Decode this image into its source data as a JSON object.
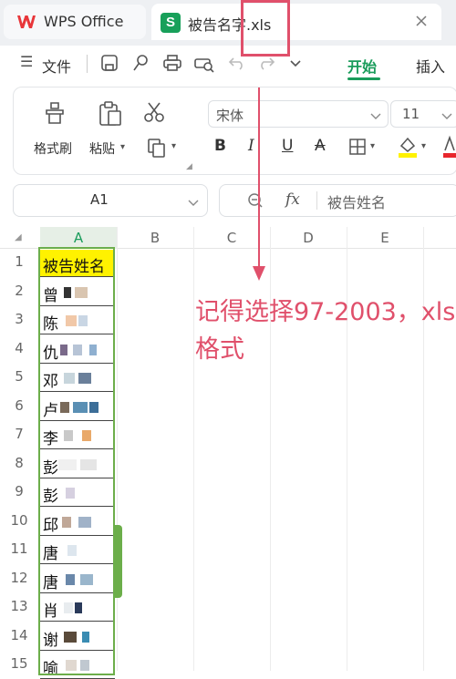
{
  "tabs": [
    {
      "label": "WPS Office"
    },
    {
      "label": "被告名字.xls"
    }
  ],
  "menu": {
    "file": "文件",
    "start": "开始",
    "insert": "插入"
  },
  "ribbon": {
    "format_painter": "格式刷",
    "paste": "粘贴",
    "font_name": "宋体",
    "font_size": "11",
    "bold": "B",
    "italic": "I",
    "underline": "U",
    "strike": "A"
  },
  "formula": {
    "cell_ref": "A1",
    "fx": "fx",
    "value": "被告姓名"
  },
  "columns": [
    "A",
    "B",
    "C",
    "D",
    "E"
  ],
  "rows": [
    "1",
    "2",
    "3",
    "4",
    "5",
    "6",
    "7",
    "8",
    "9",
    "10",
    "11",
    "12",
    "13",
    "14",
    "15"
  ],
  "cells": [
    "被告姓名",
    "曾",
    "陈",
    "仇",
    "邓",
    "卢",
    "李",
    "彭",
    "彭",
    "邱",
    "唐",
    "唐",
    "肖",
    "谢",
    "喻"
  ],
  "annotation": {
    "line1": "记得选择97-2003，xls",
    "line2": "格式"
  },
  "colors": {
    "accent": "#1a9c5b",
    "annotation": "#e0506b",
    "header_fill": "#fff200",
    "selection_border": "#6cae4a"
  }
}
